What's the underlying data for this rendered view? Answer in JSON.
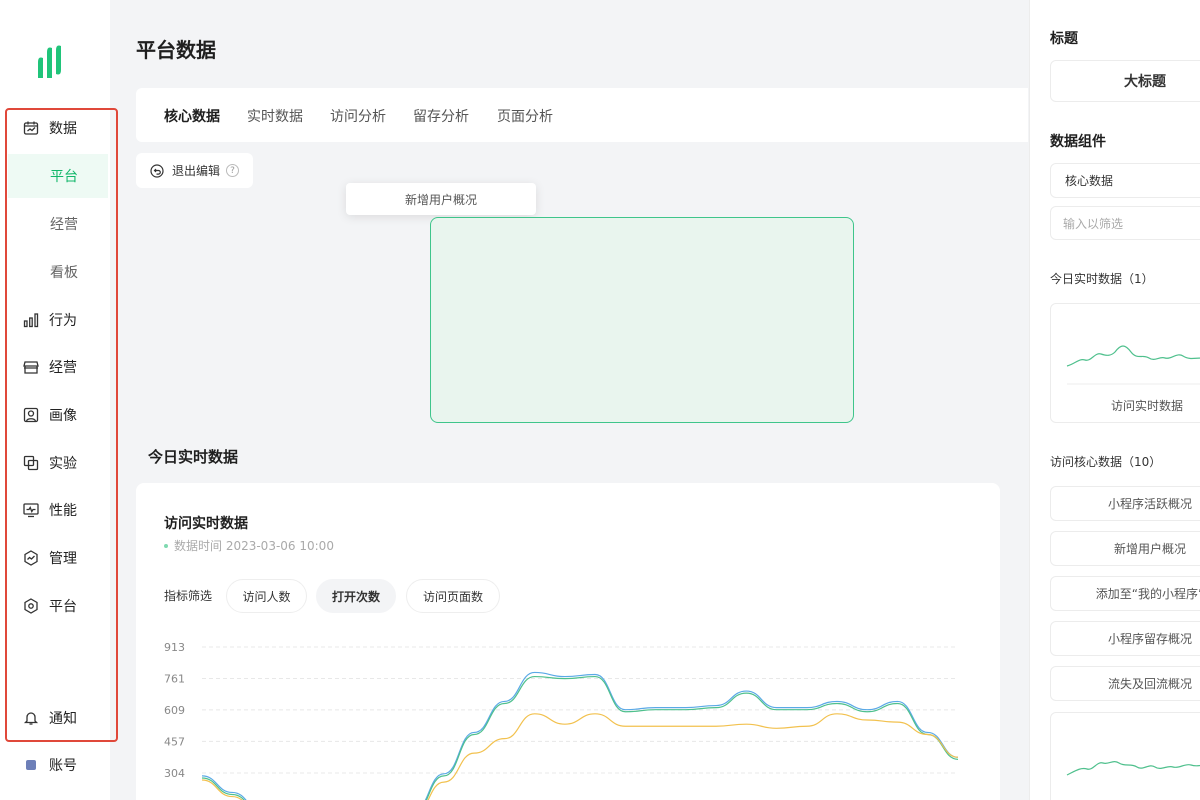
{
  "sidebar": {
    "items": [
      {
        "label": "数据",
        "icon": "calendar-chart-icon"
      },
      {
        "label": "行为",
        "icon": "bar-chart-icon"
      },
      {
        "label": "经营",
        "icon": "store-icon"
      },
      {
        "label": "画像",
        "icon": "portrait-icon"
      },
      {
        "label": "实验",
        "icon": "copy-icon"
      },
      {
        "label": "性能",
        "icon": "monitor-icon"
      },
      {
        "label": "管理",
        "icon": "hexagon-chart-icon"
      },
      {
        "label": "平台",
        "icon": "hexagon-icon"
      }
    ],
    "sub_items": [
      "平台",
      "经营",
      "看板"
    ],
    "active_sub": "平台",
    "notify": "通知",
    "account": "账号",
    "colors": {
      "accent": "#12b76a",
      "highlight_border": "#e0483a"
    }
  },
  "main": {
    "title": "平台数据",
    "tabs": [
      "核心数据",
      "实时数据",
      "访问分析",
      "留存分析",
      "页面分析"
    ],
    "active_tab": "核心数据",
    "exit_edit": "退出编辑",
    "help_glyph": "?",
    "drag_tip": "新增用户概况",
    "section_title": "今日实时数据"
  },
  "chart_card": {
    "title": "访问实时数据",
    "time_label": "数据时间 2023-03-06 10:00",
    "filter_label": "指标筛选",
    "filters": [
      "访问人数",
      "打开次数",
      "访问页面数"
    ],
    "active_filter": "打开次数"
  },
  "chart_data": {
    "type": "line",
    "y_ticks": [
      913,
      761,
      609,
      457,
      304
    ],
    "ylim": [
      0,
      913
    ],
    "x": [
      0,
      1,
      2,
      3,
      4,
      5,
      6,
      7,
      8,
      9,
      10,
      11,
      12,
      13,
      14,
      15,
      16,
      17,
      18,
      19,
      20,
      21,
      22,
      23,
      24,
      25
    ],
    "series": [
      {
        "color": "#5aa9e6",
        "values": [
          290,
          210,
          120,
          60,
          30,
          30,
          40,
          120,
          300,
          500,
          650,
          790,
          770,
          780,
          610,
          620,
          620,
          630,
          700,
          620,
          620,
          650,
          610,
          650,
          500,
          380
        ]
      },
      {
        "color": "#4fc08d",
        "values": [
          280,
          200,
          110,
          55,
          25,
          25,
          35,
          110,
          290,
          490,
          640,
          770,
          760,
          770,
          600,
          610,
          610,
          620,
          690,
          610,
          610,
          640,
          600,
          640,
          490,
          370
        ]
      },
      {
        "color": "#f2c14e",
        "values": [
          270,
          190,
          100,
          50,
          20,
          20,
          30,
          100,
          260,
          400,
          470,
          590,
          540,
          590,
          530,
          530,
          530,
          530,
          540,
          520,
          530,
          590,
          560,
          550,
          490,
          380
        ]
      }
    ]
  },
  "right_panel": {
    "title_label": "标题",
    "title_value": "大标题",
    "components_label": "数据组件",
    "select_value": "核心数据",
    "filter_placeholder": "输入以筛选",
    "group1_label": "今日实时数据（1）",
    "group1_thumb_caption": "访问实时数据",
    "group2_label": "访问核心数据（10）",
    "group2_items": [
      "小程序活跃概况",
      "新增用户概况",
      "添加至“我的小程序”",
      "小程序留存概况",
      "流失及回流概况"
    ]
  }
}
